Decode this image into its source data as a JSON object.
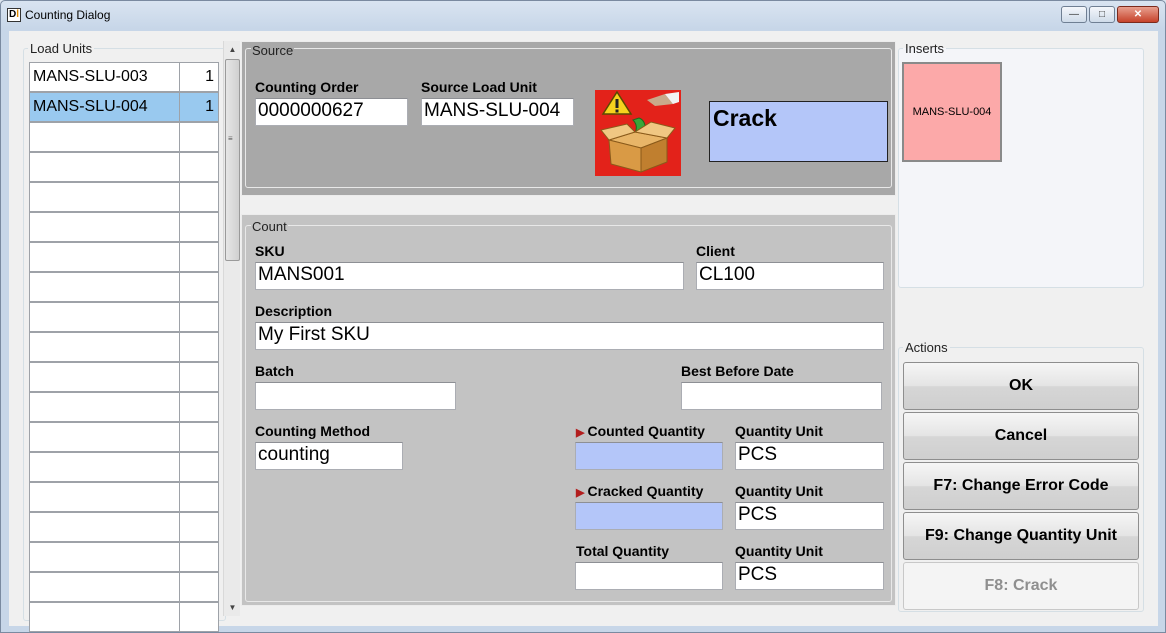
{
  "window": {
    "title": "Counting Dialog",
    "icon_letters": "Dl"
  },
  "load_units": {
    "legend": "Load Units",
    "rows": [
      {
        "name": "MANS-SLU-003",
        "count": "1",
        "selected": false
      },
      {
        "name": "MANS-SLU-004",
        "count": "1",
        "selected": true
      }
    ],
    "empty_rows": 17
  },
  "source": {
    "legend": "Source",
    "counting_order_label": "Counting Order",
    "counting_order_value": "0000000627",
    "source_load_unit_label": "Source Load Unit",
    "source_load_unit_value": "MANS-SLU-004",
    "status_text": "Crack",
    "icon": "warning-box-icon"
  },
  "count": {
    "legend": "Count",
    "sku_label": "SKU",
    "sku_value": "MANS001",
    "client_label": "Client",
    "client_value": "CL100",
    "description_label": "Description",
    "description_value": "My First SKU",
    "batch_label": "Batch",
    "batch_value": "",
    "best_before_label": "Best Before Date",
    "best_before_value": "",
    "counting_method_label": "Counting Method",
    "counting_method_value": "counting",
    "counted_qty_label": "Counted Quantity",
    "counted_qty_value": "",
    "cracked_qty_label": "Cracked Quantity",
    "cracked_qty_value": "",
    "total_qty_label": "Total Quantity",
    "total_qty_value": "",
    "qty_unit_label": "Quantity Unit",
    "qty_unit_1": "PCS",
    "qty_unit_2": "PCS",
    "qty_unit_3": "PCS"
  },
  "inserts": {
    "legend": "Inserts",
    "tile_label": "MANS-SLU-004"
  },
  "actions": {
    "legend": "Actions",
    "ok": "OK",
    "cancel": "Cancel",
    "f7": "F7: Change Error Code",
    "f9": "F9: Change Quantity Unit",
    "f8": "F8: Crack"
  },
  "colors": {
    "selected_row": "#99c9ef",
    "highlight_field": "#b4c6f9",
    "insert_tile": "#fca9a9",
    "source_bg": "#a8a8a8",
    "count_bg": "#c3c3c3"
  }
}
